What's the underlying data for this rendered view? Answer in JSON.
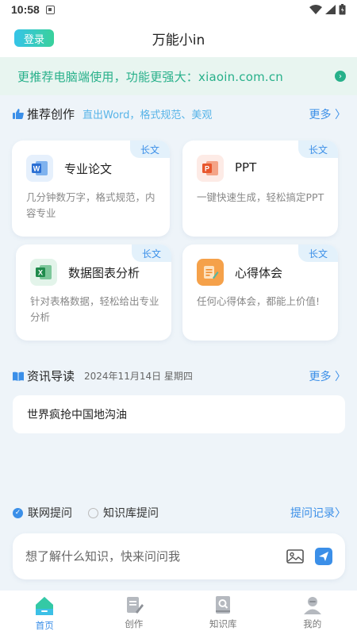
{
  "status_bar": {
    "time": "10:58"
  },
  "header": {
    "login_label": "登录",
    "title": "万能小in"
  },
  "banner": {
    "text": "更推荐电脑端使用，功能更强大：xiaoin.com.cn"
  },
  "recommend": {
    "title": "推荐创作",
    "subtitle": "直出Word，格式规范、美观",
    "more": "更多 〉",
    "cards": [
      {
        "title": "专业论文",
        "tag": "长文",
        "desc": "几分钟数万字，格式规范，内容专业",
        "icon": "word-icon"
      },
      {
        "title": "PPT",
        "tag": "长文",
        "desc": "一键快速生成，轻松搞定PPT",
        "icon": "ppt-icon"
      },
      {
        "title": "数据图表分析",
        "tag": "长文",
        "desc": "针对表格数据，轻松给出专业分析",
        "icon": "excel-icon"
      },
      {
        "title": "心得体会",
        "tag": "长文",
        "desc": "任何心得体会，都能上价值!",
        "icon": "notes-icon"
      }
    ]
  },
  "news": {
    "title": "资讯导读",
    "date": "2024年11月14日 星期四",
    "more": "更多 〉",
    "items": [
      {
        "text": "世界疯抢中国地沟油"
      }
    ]
  },
  "ask": {
    "option_web": "联网提问",
    "option_kb": "知识库提问",
    "history": "提问记录〉",
    "placeholder": "想了解什么知识，快来问问我"
  },
  "tabs": [
    {
      "label": "首页",
      "active": true
    },
    {
      "label": "创作",
      "active": false
    },
    {
      "label": "知识库",
      "active": false
    },
    {
      "label": "我的",
      "active": false
    }
  ],
  "colors": {
    "accent": "#3b8fe8",
    "green": "#27b08a",
    "background": "#eef4f9"
  }
}
